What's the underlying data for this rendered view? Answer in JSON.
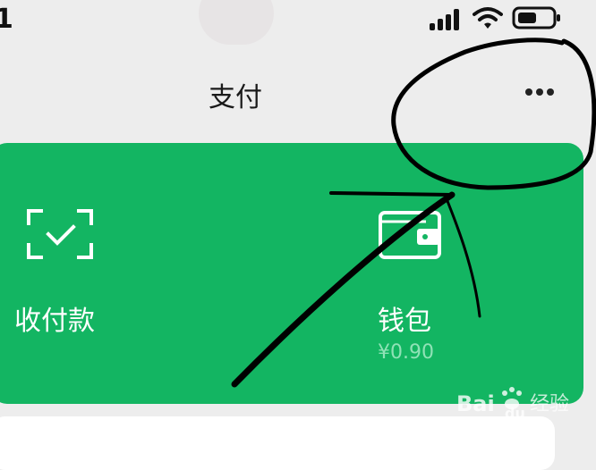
{
  "status_bar": {
    "time_fragment": "1",
    "icons": [
      "signal-icon",
      "wifi-icon",
      "battery-icon"
    ]
  },
  "header": {
    "title": "支付",
    "more_icon": "more-icon"
  },
  "card": {
    "color": "#13b562",
    "actions": [
      {
        "label": "收付款",
        "icon": "scan-icon"
      },
      {
        "label": "钱包",
        "icon": "wallet-icon",
        "balance": "¥0.90"
      }
    ]
  },
  "annotation": {
    "color": "#000000",
    "shapes": [
      "circle-annotation",
      "arrow-annotation"
    ]
  },
  "watermark": {
    "logo": "Bai du",
    "text": "经验"
  }
}
